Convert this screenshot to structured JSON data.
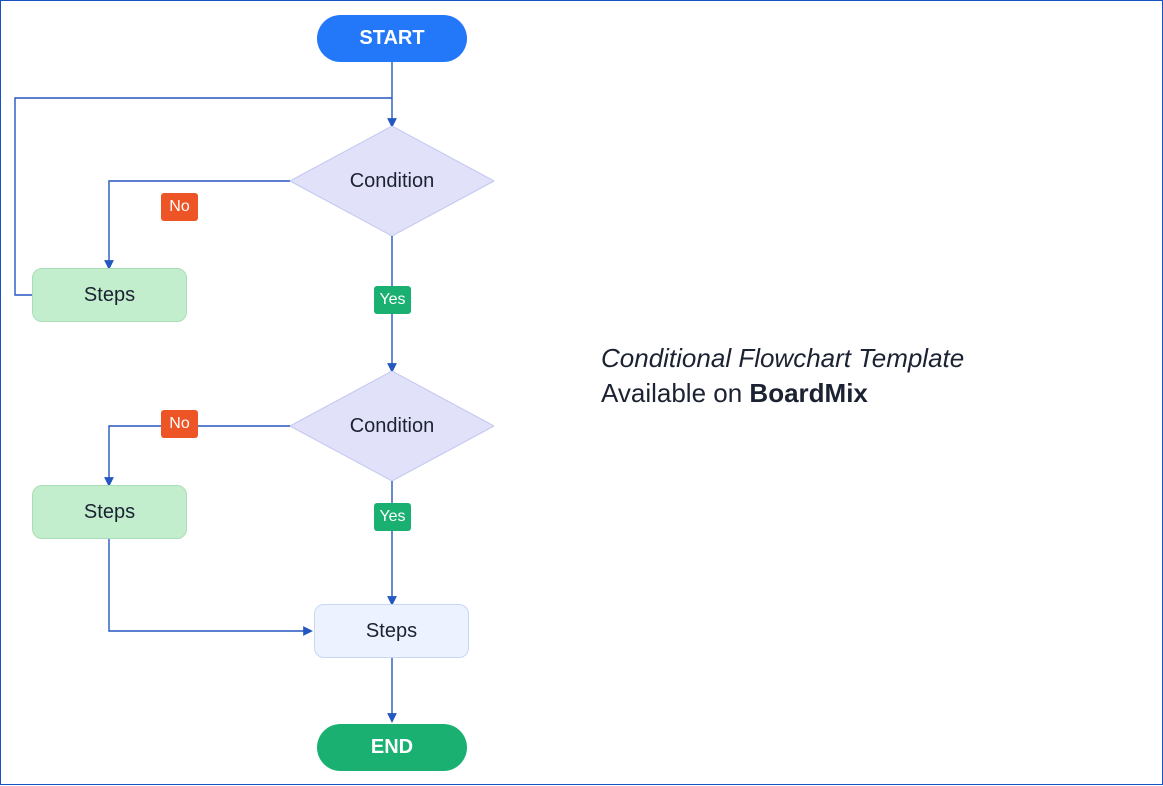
{
  "nodes": {
    "start": "START",
    "condition1": "Condition",
    "condition2": "Condition",
    "steps_left1": "Steps",
    "steps_left2": "Steps",
    "steps_main": "Steps",
    "end": "END"
  },
  "edges": {
    "no1": "No",
    "yes1": "Yes",
    "no2": "No",
    "yes2": "Yes"
  },
  "caption": {
    "title": "Conditional Flowchart Template",
    "available_prefix": "Available on ",
    "brand": "BoardMix"
  },
  "colors": {
    "start": "#2377F9",
    "end": "#1AB072",
    "diamond_fill": "#E1E2F9",
    "diamond_stroke": "#C4C7F0",
    "process_green": "#C2EECD",
    "process_light": "#ECF2FF",
    "tag_no": "#ED5426",
    "tag_yes": "#1AB072",
    "line": "#2457BF"
  }
}
